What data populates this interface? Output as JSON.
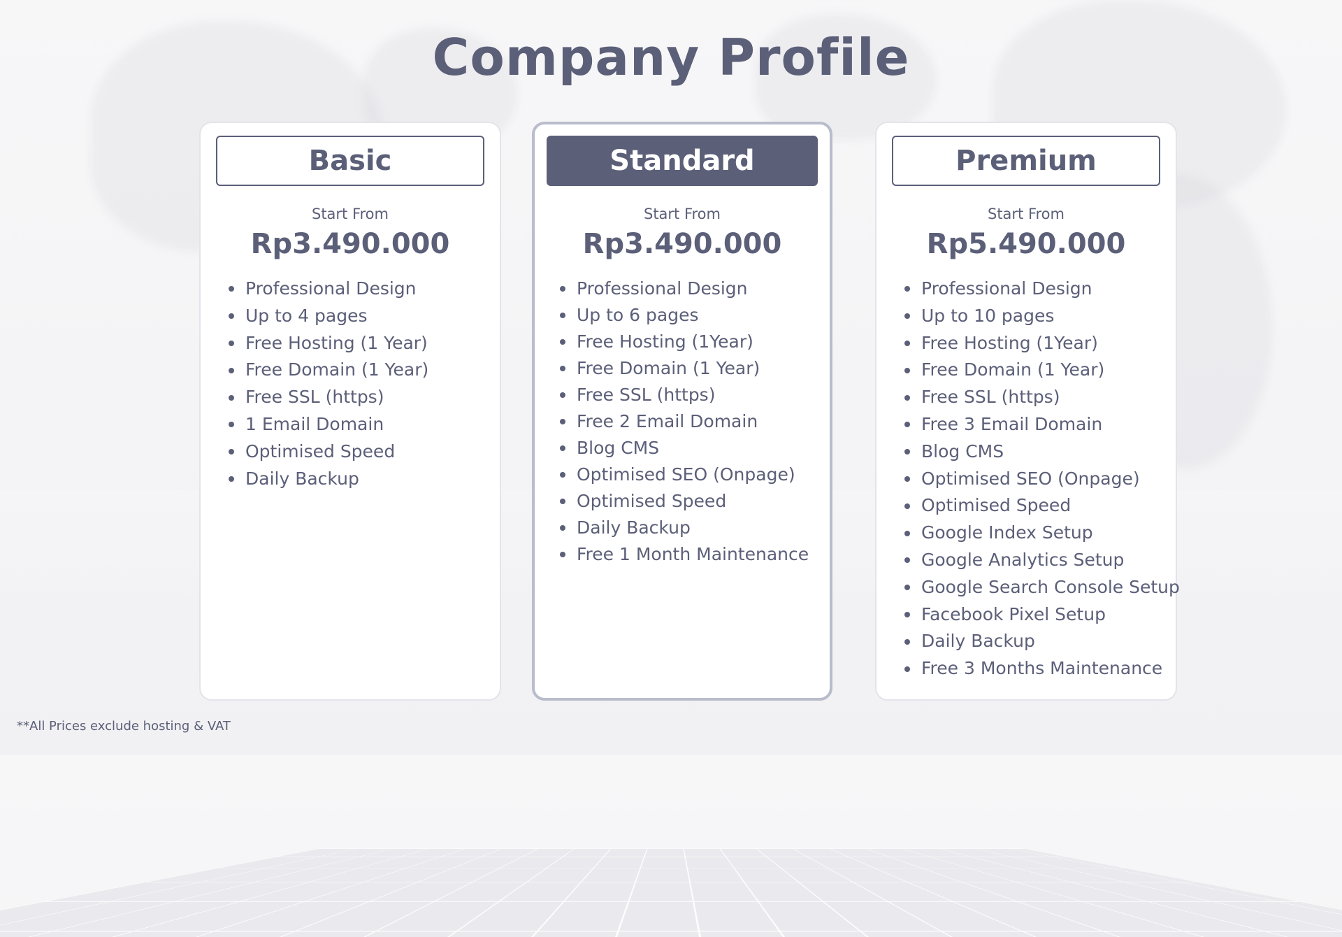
{
  "title": "Company Profile",
  "plans": [
    {
      "name": "Basic",
      "start_label": "Start From",
      "price": "Rp3.490.000",
      "features": [
        "Professional Design",
        "Up to 4 pages",
        "Free Hosting (1 Year)",
        "Free Domain (1 Year)",
        "Free SSL (https)",
        "1 Email Domain",
        "Optimised Speed",
        "Daily Backup"
      ]
    },
    {
      "name": "Standard",
      "start_label": "Start From",
      "price": "Rp3.490.000",
      "features": [
        "Professional Design",
        "Up to 6 pages",
        "Free Hosting (1Year)",
        "Free Domain (1 Year)",
        "Free SSL (https)",
        "Free 2 Email Domain",
        "Blog CMS",
        "Optimised SEO (Onpage)",
        "Optimised Speed",
        "Daily Backup",
        "Free 1 Month Maintenance"
      ]
    },
    {
      "name": "Premium",
      "start_label": "Start From",
      "price": "Rp5.490.000",
      "features": [
        "Professional Design",
        "Up to 10 pages",
        "Free Hosting (1Year)",
        "Free Domain (1 Year)",
        "Free SSL (https)",
        "Free 3 Email Domain",
        "Blog CMS",
        "Optimised SEO (Onpage)",
        "Optimised Speed",
        "Google Index Setup",
        "Google Analytics Setup",
        "Google Search Console Setup",
        "Facebook Pixel Setup",
        "Daily Backup",
        "Free 3 Months Maintenance"
      ]
    }
  ],
  "footnote": "**All Prices exclude hosting & VAT",
  "colors": {
    "text": "#5b5f78",
    "featured_header": "#5b5f78",
    "card_background": "#ffffff"
  }
}
